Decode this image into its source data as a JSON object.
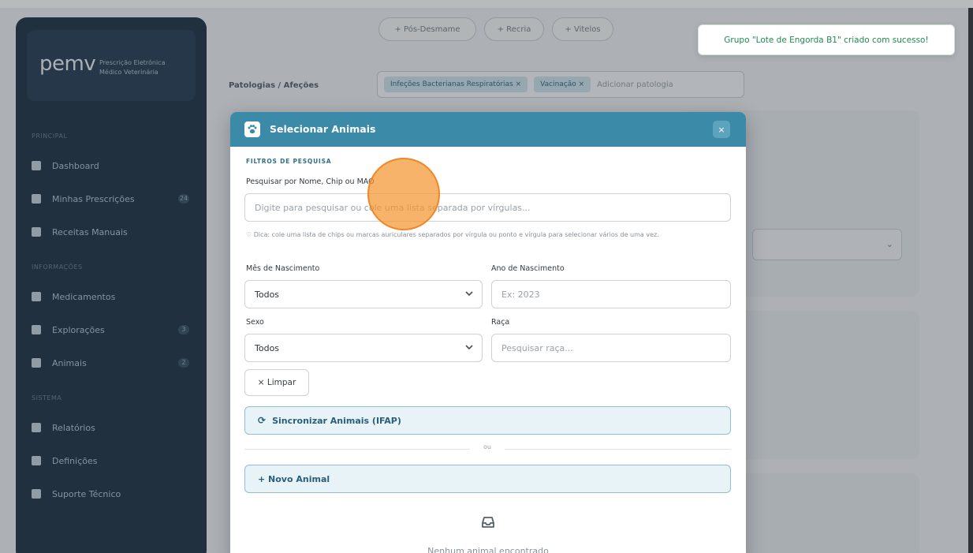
{
  "sidebar": {
    "logo": "pemv",
    "logo_sub_1": "Prescrição Eletrónica",
    "logo_sub_2": "Médico Veterinária",
    "sections": [
      "PRINCIPAL",
      "INFORMAÇÕES",
      "SISTEMA"
    ],
    "items": [
      {
        "label": "Dashboard",
        "count": ""
      },
      {
        "label": "Minhas Prescrições",
        "count": "24"
      },
      {
        "label": "Receitas Manuais",
        "count": ""
      },
      {
        "label": "Medicamentos",
        "count": ""
      },
      {
        "label": "Explorações",
        "count": "3"
      },
      {
        "label": "Animais",
        "count": "2"
      },
      {
        "label": "Relatórios",
        "count": ""
      },
      {
        "label": "Definições",
        "count": ""
      },
      {
        "label": "Suporte Técnico",
        "count": ""
      }
    ]
  },
  "background": {
    "pills": [
      "+ Pós-Desmame",
      "+ Recria",
      "+ Vitelos"
    ],
    "pathologies_label": "Patologias / Afeções",
    "tags": [
      "Infeções Bacterianas Respiratórias ×",
      "Vacinação ×"
    ],
    "tags_placeholder": "Adicionar patologia"
  },
  "toast": {
    "message": "Grupo \"Lote de Engorda B1\" criado com sucesso!",
    "color": "#1f8a4c"
  },
  "modal": {
    "title": "Selecionar Animais",
    "close_label": "×",
    "header_color": "#3a8aa8",
    "filters_title": "FILTROS DE PESQUISA",
    "search_label": "Pesquisar por Nome, Chip ou MAO",
    "search_placeholder": "Digite para pesquisar ou cole uma lista separada por vírgulas...",
    "hint": "Dica: cole uma lista de chips ou marcas auriculares separados por vírgula ou ponto e vírgula para selecionar vários de uma vez.",
    "birth_month_label": "Mês de Nascimento",
    "birth_month_value": "Todos",
    "birth_year_label": "Ano de Nascimento",
    "birth_year_placeholder": "Ex: 2023",
    "sex_label": "Sexo",
    "sex_value": "Todos",
    "breed_label": "Raça",
    "breed_placeholder": "Pesquisar raça...",
    "clear_label": "× Limpar",
    "sync_label": "Sincronizar Animais (IFAP)",
    "divider_text": "ou",
    "new_animal_label": "+ Novo Animal",
    "empty_text": "Nenhum animal encontrado"
  }
}
